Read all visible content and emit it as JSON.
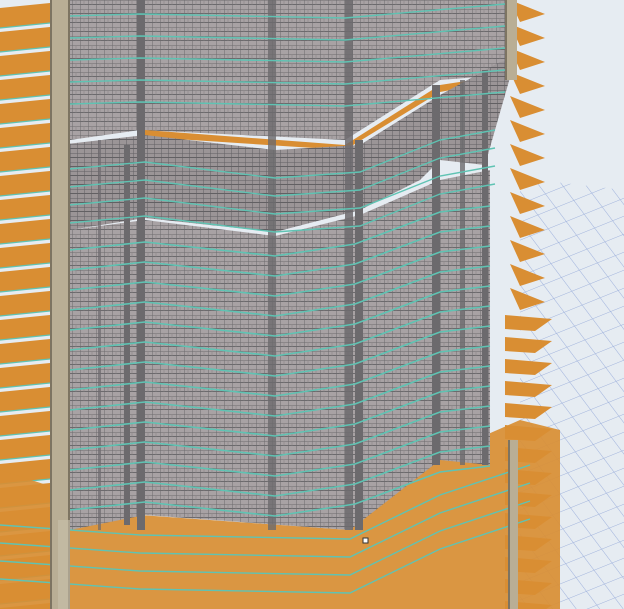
{
  "viewport": {
    "label": "",
    "colors": {
      "background": "#e6ecf2",
      "grid_line": "#9fb2dc",
      "slab": "#d98e33",
      "slab_dark": "#b87424",
      "slab_edge": "#5fc3b3",
      "curtain_wall": "#a8a2a4",
      "mullion": "#6c6a6d",
      "column": "#b9ae95",
      "column_edge": "#7d7462",
      "selection_handle": "#ffffff"
    }
  },
  "scene": {
    "elements": [
      "background-floor-grid",
      "stacked-floor-slabs",
      "structural-columns",
      "tower-curtain-wall",
      "podium-curtain-wall",
      "selection-handle"
    ]
  }
}
